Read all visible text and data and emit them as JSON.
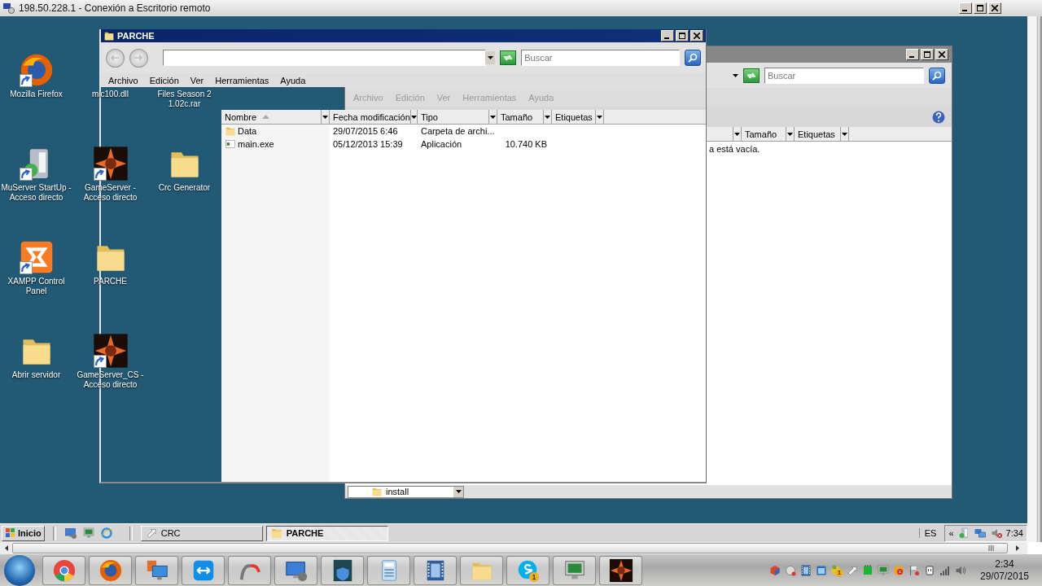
{
  "window": {
    "title": "198.50.228.1 - Conexión a Escritorio remoto"
  },
  "desktop_icons": [
    {
      "label": "Mozilla Firefox",
      "kind": "firefox",
      "shortcut": true
    },
    {
      "label": "MuServer StartUp -\nAcceso directo",
      "kind": "server",
      "shortcut": true
    },
    {
      "label": "XAMPP Control\nPanel",
      "kind": "xampp",
      "shortcut": true
    },
    {
      "label": "Abrir servidor",
      "kind": "folder",
      "shortcut": false
    },
    {
      "label": "mlc100.dll"
    },
    {
      "label": "GameServer -\nAcceso directo",
      "kind": "emblem",
      "shortcut": true
    },
    {
      "label": "PARCHE",
      "kind": "folder",
      "shortcut": false
    },
    {
      "label": "GameServer_CS -\nAcceso directo",
      "kind": "emblem",
      "shortcut": true
    },
    {
      "label": "Files Season 2\n1.02c.rar"
    },
    {
      "label": "Crc Generator",
      "kind": "folder",
      "shortcut": false
    }
  ],
  "back_window": {
    "search": {
      "placeholder": "Buscar"
    },
    "menu": [
      "Archivo",
      "Edición",
      "Ver",
      "Herramientas",
      "Ayuda"
    ],
    "columns": [
      "Tamaño",
      "Etiquetas"
    ],
    "message": "a está vacía.",
    "location": "install"
  },
  "front_window": {
    "title": "PARCHE",
    "search": {
      "placeholder": "Buscar"
    },
    "menu": [
      "Archivo",
      "Edición",
      "Ver",
      "Herramientas",
      "Ayuda"
    ],
    "columns": [
      {
        "label": "Nombre",
        "sorted": true
      },
      {
        "label": "Fecha modificación",
        "sorted": false
      },
      {
        "label": "Tipo",
        "sorted": false
      },
      {
        "label": "Tamaño",
        "sorted": false
      },
      {
        "label": "Etiquetas",
        "sorted": false
      }
    ],
    "rows": [
      {
        "kind": "folder",
        "name": "Data",
        "modified": "29/07/2015 6:46",
        "type": "Carpeta de archi..."
      },
      {
        "kind": "exe",
        "name": "main.exe",
        "modified": "05/12/2013 15:39",
        "type": "Aplicación",
        "size": "10.740 KB"
      }
    ]
  },
  "remote_taskbar": {
    "start": "Inicio",
    "quick_launch": [
      {
        "kind": "desktop"
      },
      {
        "kind": "monitor"
      },
      {
        "kind": "ie"
      }
    ],
    "tasks": [
      {
        "label": "CRC",
        "kind": "up",
        "selected": false
      },
      {
        "label": "PARCHE",
        "kind": "folder",
        "selected": true
      }
    ],
    "language": "ES",
    "tray_toggle": "«",
    "tray_icons": [
      {
        "kind": "server"
      },
      {
        "kind": "network"
      },
      {
        "kind": "muted"
      }
    ],
    "clock": "7:34"
  },
  "taskbar": {
    "apps": [
      {
        "kind": "chrome"
      },
      {
        "kind": "firefox"
      },
      {
        "kind": "presenter"
      },
      {
        "kind": "teamviewer"
      },
      {
        "kind": "swirl"
      },
      {
        "kind": "rdp"
      },
      {
        "kind": "shield"
      },
      {
        "kind": "calculator"
      },
      {
        "kind": "film"
      },
      {
        "kind": "explorer"
      },
      {
        "kind": "skype",
        "badge": "1"
      },
      {
        "kind": "monitor"
      },
      {
        "kind": "emblem"
      }
    ],
    "tray_icons": [
      {
        "kind": "cube"
      },
      {
        "kind": "globe"
      },
      {
        "kind": "film"
      },
      {
        "kind": "window"
      },
      {
        "kind": "coin",
        "badge": "1"
      },
      {
        "kind": "arrow"
      },
      {
        "kind": "chip"
      },
      {
        "kind": "monitor"
      },
      {
        "kind": "stop"
      },
      {
        "kind": "flag"
      },
      {
        "kind": "plug"
      },
      {
        "kind": "signal"
      },
      {
        "kind": "speaker"
      }
    ],
    "time": "2:34",
    "date": "29/07/2015"
  }
}
